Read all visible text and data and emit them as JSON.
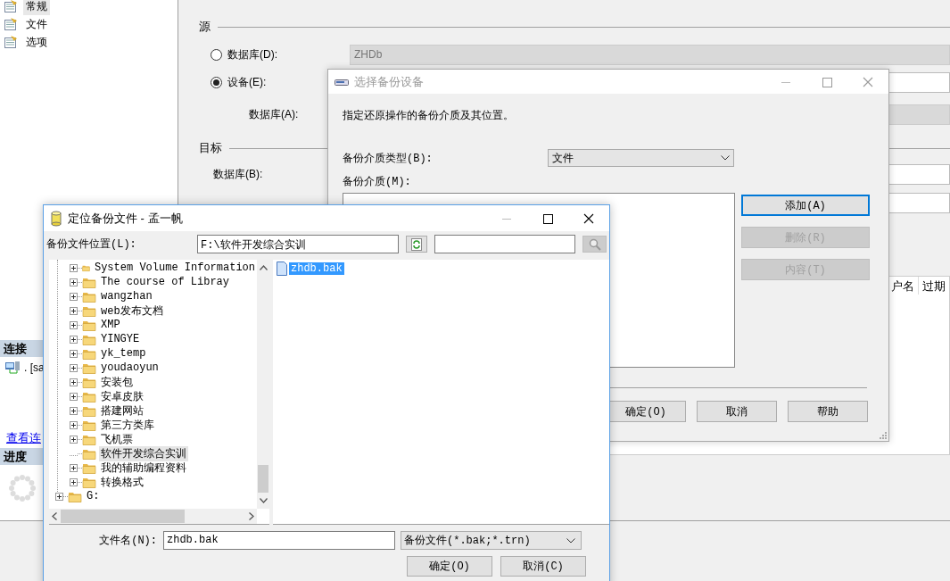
{
  "main_window": {
    "pages": [
      {
        "label": "常规",
        "selected": true
      },
      {
        "label": "文件",
        "selected": false
      },
      {
        "label": "选项",
        "selected": false
      }
    ],
    "connection": {
      "title": "连接",
      "server": ". [sa",
      "link": "查看连"
    },
    "progress": {
      "title": "进度"
    },
    "source": {
      "title": "源",
      "options": [
        {
          "label": "数据库(D):",
          "selected": false,
          "value": "ZHDb"
        },
        {
          "label": "设备(E):",
          "selected": true
        }
      ],
      "database_label": "数据库(A):"
    },
    "destination": {
      "title": "目标",
      "database_label": "数据库(B):"
    },
    "table": {
      "columns": [
        "户名",
        "过期"
      ]
    }
  },
  "backup_device_dialog": {
    "title": "选择备份设备",
    "active": false,
    "description": "指定还原操作的备份介质及其位置。",
    "media_type_label": "备份介质类型(B):",
    "media_type": "文件",
    "media_label": "备份介质(M):",
    "side_buttons": [
      {
        "label": "添加(A)",
        "disabled": false,
        "focused": true
      },
      {
        "label": "删除(R)",
        "disabled": true,
        "focused": false
      },
      {
        "label": "内容(T)",
        "disabled": true,
        "focused": false
      }
    ],
    "buttons": [
      "确定(O)",
      "取消",
      "帮助"
    ]
  },
  "locate_file_dialog": {
    "title": "定位备份文件 - 孟一帆",
    "active": true,
    "location_label": "备份文件位置(L):",
    "location": "F:\\软件开发综合实训",
    "tree": {
      "visible_children": [
        {
          "label": "System Volume Information",
          "expandable": true,
          "selected": false
        },
        {
          "label": "The course of Libray",
          "expandable": true,
          "selected": false
        },
        {
          "label": "wangzhan",
          "expandable": true,
          "selected": false
        },
        {
          "label": "web发布文档",
          "expandable": true,
          "selected": false
        },
        {
          "label": "XMP",
          "expandable": true,
          "selected": false
        },
        {
          "label": "YINGYE",
          "expandable": true,
          "selected": false
        },
        {
          "label": "yk_temp",
          "expandable": true,
          "selected": false
        },
        {
          "label": "youdaoyun",
          "expandable": true,
          "selected": false
        },
        {
          "label": "安装包",
          "expandable": true,
          "selected": false
        },
        {
          "label": "安卓皮肤",
          "expandable": true,
          "selected": false
        },
        {
          "label": "搭建网站",
          "expandable": true,
          "selected": false
        },
        {
          "label": "第三方类库",
          "expandable": true,
          "selected": false
        },
        {
          "label": "飞机票",
          "expandable": true,
          "selected": false
        },
        {
          "label": "软件开发综合实训",
          "expandable": false,
          "selected": true
        },
        {
          "label": "我的辅助编程资料",
          "expandable": true,
          "selected": false
        },
        {
          "label": "转换格式",
          "expandable": true,
          "selected": false
        }
      ],
      "roots": [
        {
          "label": "G:",
          "expandable": true,
          "selected": false
        }
      ]
    },
    "files": [
      {
        "name": "zhdb.bak",
        "selected": true
      }
    ],
    "file_name_label": "文件名(N):",
    "file_name": "zhdb.bak",
    "file_type": "备份文件(*.bak;*.trn)",
    "buttons": [
      "确定(O)",
      "取消(C)"
    ]
  }
}
